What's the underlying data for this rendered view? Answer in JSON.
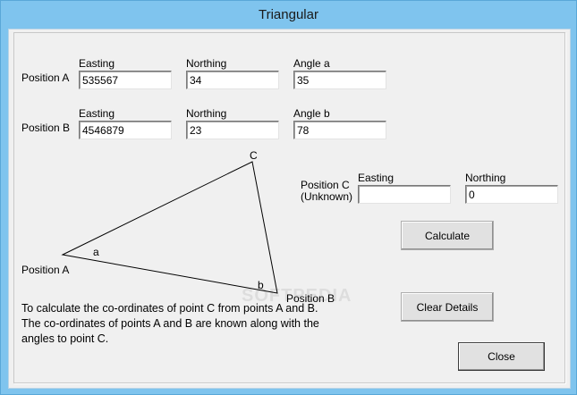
{
  "window": {
    "title": "Triangular"
  },
  "position_a": {
    "label": "Position A",
    "easting_label": "Easting",
    "northing_label": "Northing",
    "angle_label": "Angle a",
    "easting": "535567",
    "northing": "34",
    "angle": "35"
  },
  "position_b": {
    "label": "Position B",
    "easting_label": "Easting",
    "northing_label": "Northing",
    "angle_label": "Angle b",
    "easting": "4546879",
    "northing": "23",
    "angle": "78"
  },
  "position_c": {
    "label_line1": "Position C",
    "label_line2": "(Unknown)",
    "easting_label": "Easting",
    "northing_label": "Northing",
    "easting": "",
    "northing": "0"
  },
  "diagram": {
    "vertex_c": "C",
    "vertex_a": "Position A",
    "vertex_b": "Position B",
    "angle_a": "a",
    "angle_b": "b"
  },
  "buttons": {
    "calculate": "Calculate",
    "clear": "Clear Details",
    "close": "Close"
  },
  "description": "To calculate the co-ordinates of point C from points A and B. The co-ordinates of points A and B are known along with the angles to point C.",
  "watermark": "SOFTPEDIA"
}
